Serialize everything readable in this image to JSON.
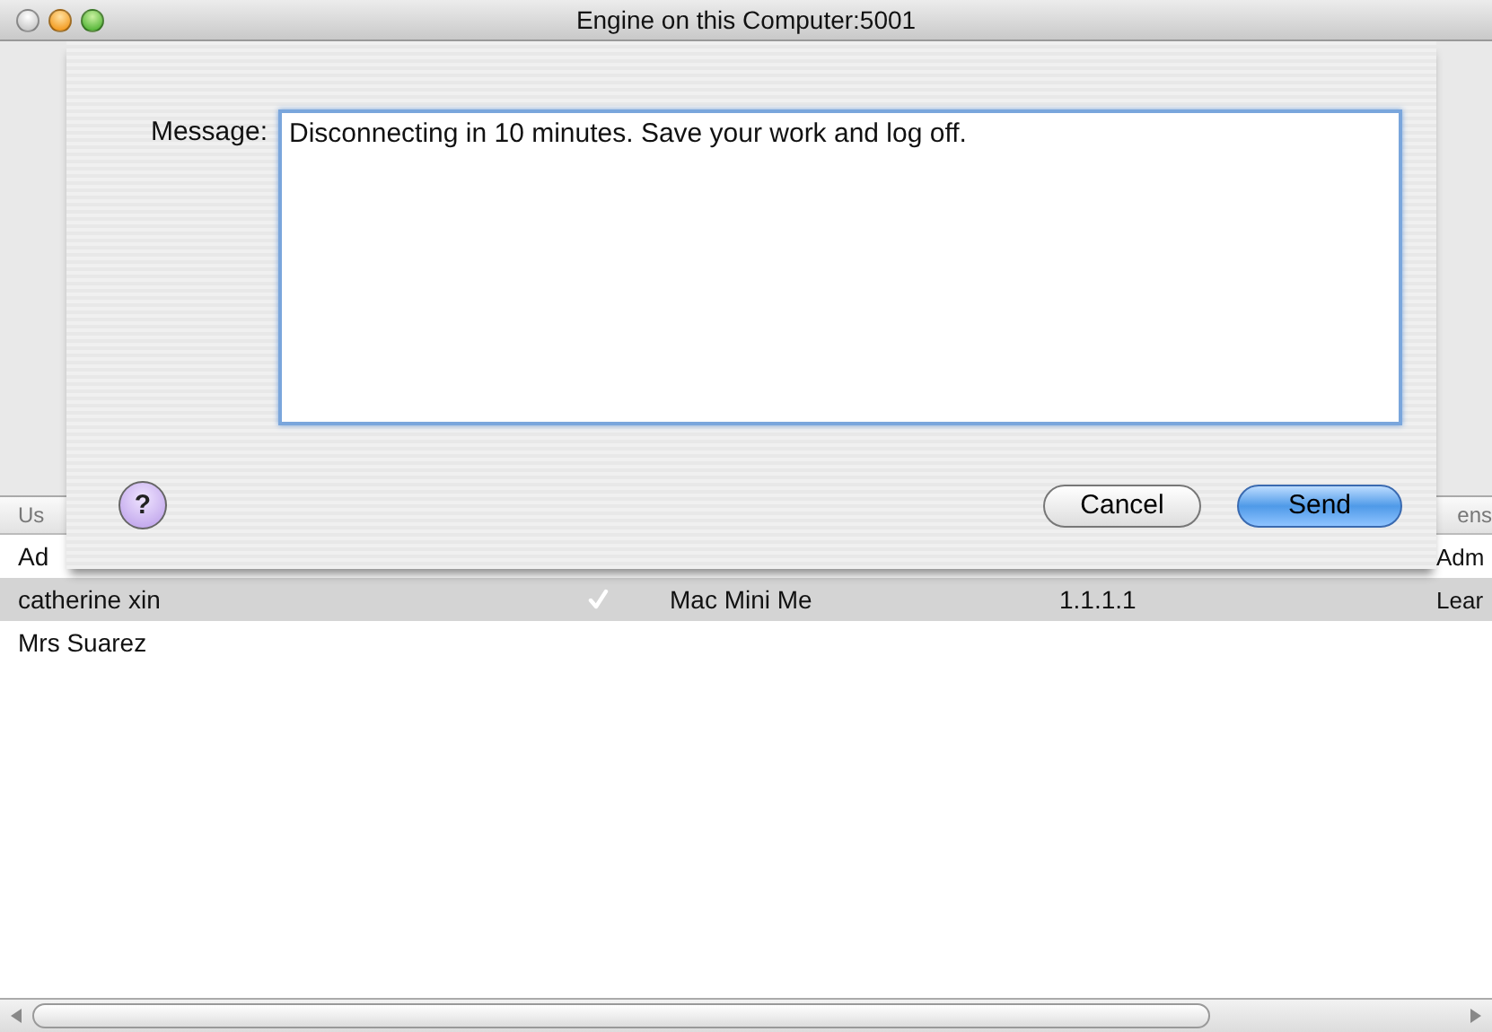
{
  "window": {
    "title": "Engine on this Computer:5001"
  },
  "table": {
    "header": {
      "first": "Us",
      "last": "ens"
    },
    "rows": [
      {
        "user": "Ad",
        "license": "Adm",
        "selected": false
      },
      {
        "user": "catherine xin",
        "logged_in": true,
        "machine": "Mac Mini Me",
        "address": "1.1.1.1",
        "license": "Lear",
        "selected": true
      },
      {
        "user": "Mrs Suarez",
        "selected": false,
        "logged_in": false
      }
    ]
  },
  "sheet": {
    "label": "Message:",
    "message": "Disconnecting in 10 minutes. Save your work and log off.",
    "help": "?",
    "buttons": [
      {
        "label": "Cancel",
        "kind": "normal"
      },
      {
        "label": "Send",
        "kind": "default"
      }
    ]
  }
}
